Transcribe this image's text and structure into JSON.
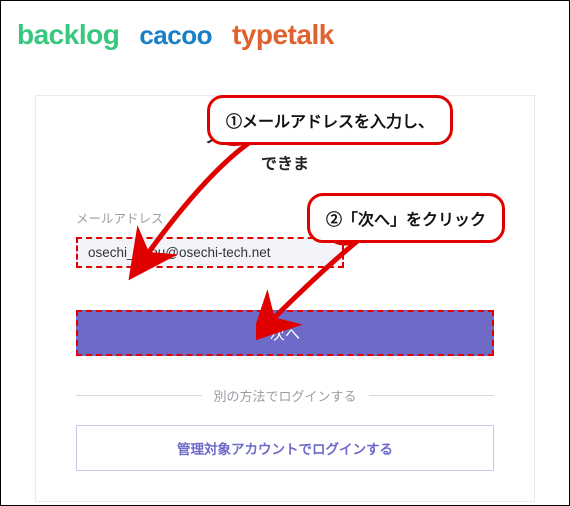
{
  "logos": {
    "backlog": "backlog",
    "cacoo": "cacoo",
    "typetalk": "typetalk"
  },
  "panel": {
    "heading_line1": "ヌーラボアカウントを",
    "heading_line2": "できま",
    "email_label": "メールアドレス",
    "email_value": "osechi_tarou@osechi-tech.net",
    "next_label": "次へ",
    "divider_label": "別の方法でログインする",
    "alt_login_label": "管理対象アカウントでログインする"
  },
  "callouts": {
    "c1": "①メールアドレスを入力し、",
    "c2": "②「次へ」をクリック"
  },
  "colors": {
    "highlight": "#e00000",
    "primary": "#6e6ac8"
  }
}
